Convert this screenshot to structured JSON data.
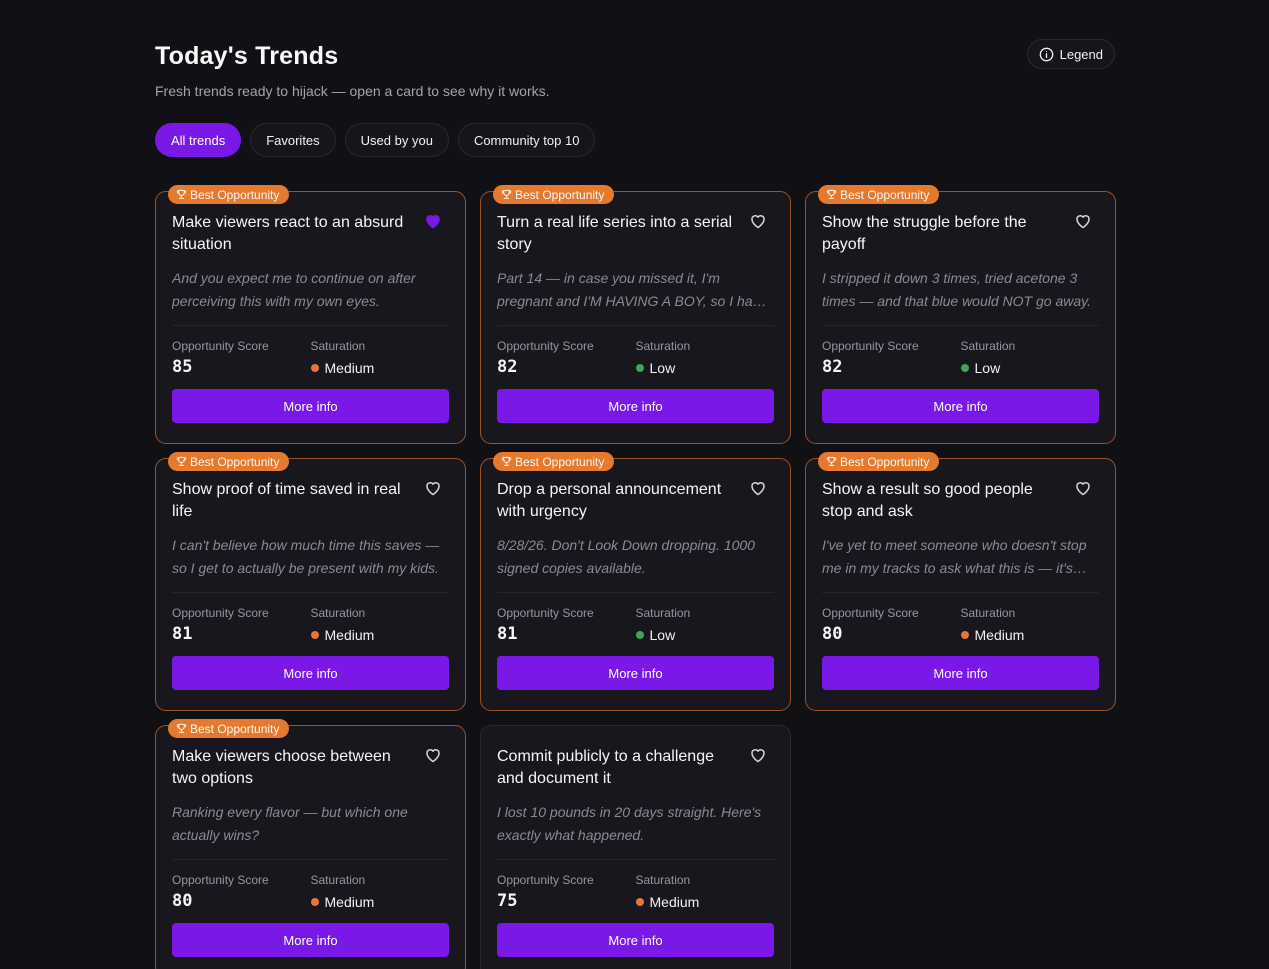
{
  "header": {
    "title": "Today's Trends",
    "subtitle": "Fresh trends ready to hijack — open a card to see why it works.",
    "legend_label": "Legend"
  },
  "filters": [
    {
      "label": "All trends",
      "active": true
    },
    {
      "label": "Favorites",
      "active": false
    },
    {
      "label": "Used by you",
      "active": false
    },
    {
      "label": "Community top 10",
      "active": false
    }
  ],
  "labels": {
    "score_label": "Opportunity Score",
    "saturation_label": "Saturation",
    "more_info": "More info",
    "best_badge": "Best Opportunity"
  },
  "colors": {
    "accent": "#7a18e8",
    "badge": "#e57a2f",
    "medium": "#e8763a",
    "low": "#3fa55a"
  },
  "cards": [
    {
      "title": "Make viewers react to an absurd situation",
      "quote": "And you expect me to continue on after perceiving this with my own eyes.",
      "score": "85",
      "saturation": "Medium",
      "best": true,
      "favorited": true
    },
    {
      "title": "Turn a real life series into a serial story",
      "quote": "Part 14 — in case you missed it, I'm pregnant and I'M HAVING A BOY, so I had to…",
      "score": "82",
      "saturation": "Low",
      "best": true,
      "favorited": false
    },
    {
      "title": "Show the struggle before the payoff",
      "quote": "I stripped it down 3 times, tried acetone 3 times — and that blue would NOT go away.",
      "score": "82",
      "saturation": "Low",
      "best": true,
      "favorited": false
    },
    {
      "title": "Show proof of time saved in real life",
      "quote": "I can't believe how much time this saves — so I get to actually be present with my kids.",
      "score": "81",
      "saturation": "Medium",
      "best": true,
      "favorited": false
    },
    {
      "title": "Drop a personal announcement with urgency",
      "quote": "8/28/26. Don't Look Down dropping. 1000 signed copies available.",
      "score": "81",
      "saturation": "Low",
      "best": true,
      "favorited": false
    },
    {
      "title": "Show a result so good people stop and ask",
      "quote": "I've yet to meet someone who doesn't stop me in my tracks to ask what this is — it's…",
      "score": "80",
      "saturation": "Medium",
      "best": true,
      "favorited": false
    },
    {
      "title": "Make viewers choose between two options",
      "quote": "Ranking every flavor — but which one actually wins?",
      "score": "80",
      "saturation": "Medium",
      "best": true,
      "favorited": false
    },
    {
      "title": "Commit publicly to a challenge and document it",
      "quote": "I lost 10 pounds in 20 days straight. Here's exactly what happened.",
      "score": "75",
      "saturation": "Medium",
      "best": false,
      "favorited": false
    }
  ]
}
